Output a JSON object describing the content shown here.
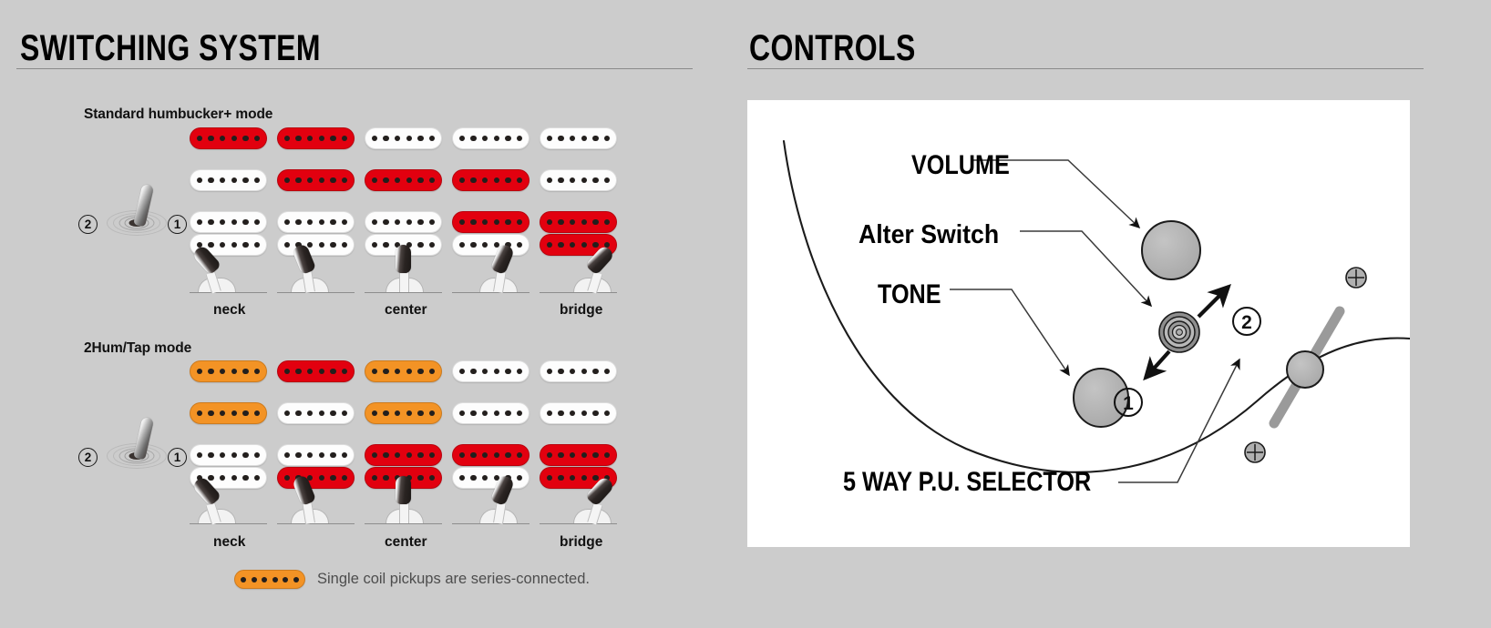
{
  "panels": {
    "switching": {
      "title": "SWITCHING SYSTEM"
    },
    "controls": {
      "title": "CONTROLS"
    }
  },
  "switching": {
    "modes": [
      {
        "label": "Standard humbucker+ mode",
        "toggle": {
          "left_badge": "2",
          "right_badge": "1"
        },
        "positions": [
          {
            "label": "neck",
            "show_label": true
          },
          {
            "label": "",
            "show_label": false
          },
          {
            "label": "center",
            "show_label": true
          },
          {
            "label": "",
            "show_label": false
          },
          {
            "label": "bridge",
            "show_label": true
          }
        ],
        "coil_matrix": {
          "rows": 4,
          "columns": 5,
          "values": [
            [
              "red",
              "red",
              "white",
              "white",
              "white"
            ],
            [
              "white",
              "red",
              "red",
              "red",
              "white"
            ],
            [
              "white",
              "white",
              "white",
              "red",
              "red"
            ],
            [
              "white",
              "white",
              "white",
              "white",
              "red"
            ]
          ]
        }
      },
      {
        "label": "2Hum/Tap mode",
        "toggle": {
          "left_badge": "2",
          "right_badge": "1"
        },
        "positions": [
          {
            "label": "neck",
            "show_label": true
          },
          {
            "label": "",
            "show_label": false
          },
          {
            "label": "center",
            "show_label": true
          },
          {
            "label": "",
            "show_label": false
          },
          {
            "label": "bridge",
            "show_label": true
          }
        ],
        "coil_matrix": {
          "rows": 4,
          "columns": 5,
          "values": [
            [
              "orange",
              "red",
              "orange",
              "white",
              "white"
            ],
            [
              "orange",
              "white",
              "orange",
              "white",
              "white"
            ],
            [
              "white",
              "white",
              "red",
              "red",
              "red"
            ],
            [
              "white",
              "red",
              "red",
              "white",
              "red"
            ]
          ]
        }
      }
    ],
    "legend": {
      "swatch_color": "orange",
      "text": "Single coil pickups are series-connected."
    }
  },
  "controls": {
    "labels": {
      "volume": "VOLUME",
      "alter_switch": "Alter Switch",
      "tone": "TONE",
      "selector": "5 WAY P.U. SELECTOR"
    },
    "alter_switch_positions": {
      "up": "2",
      "down": "1"
    }
  },
  "colors": {
    "background": "#cccccc",
    "coil_red": "#e2000f",
    "coil_orange": "#f39325",
    "coil_white": "#fdfdfd",
    "pole": "#231f1d",
    "knob_fill": "#b3b3b3",
    "canvas": "#ffffff",
    "rule": "#8a8a8a",
    "legend_text": "#4d4d4d"
  }
}
